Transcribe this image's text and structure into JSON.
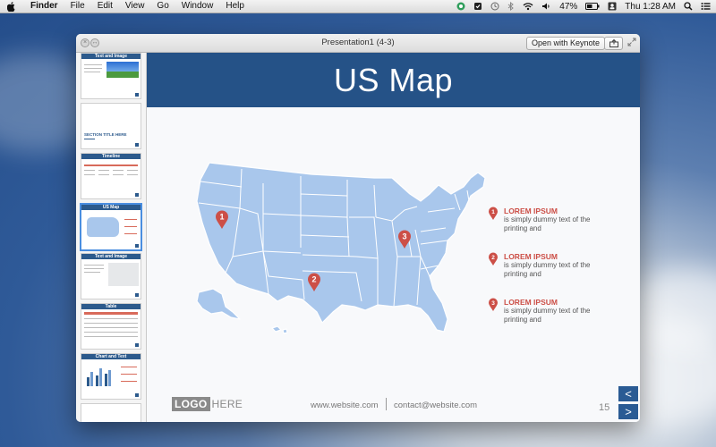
{
  "menubar": {
    "app": "Finder",
    "items": [
      "File",
      "Edit",
      "View",
      "Go",
      "Window",
      "Help"
    ],
    "battery": "47%",
    "clock": "Thu 1:28 AM"
  },
  "window": {
    "title": "Presentation1 (4-3)",
    "open_button": "Open with Keynote"
  },
  "sidebar": {
    "thumbnails": [
      {
        "label": "Text and Image"
      },
      {
        "label": "SECTION TITLE HERE"
      },
      {
        "label": "Timeline"
      },
      {
        "label": "US Map"
      },
      {
        "label": "Text and Image"
      },
      {
        "label": "Table"
      },
      {
        "label": "Chart and Text"
      }
    ]
  },
  "slide": {
    "title": "US Map",
    "pins": [
      "1",
      "2",
      "3"
    ],
    "legend": [
      {
        "number": "1",
        "title": "LOREM IPSUM",
        "line1": "is simply dummy text of the",
        "line2": "printing and"
      },
      {
        "number": "2",
        "title": "LOREM IPSUM",
        "line1": "is simply dummy text of the",
        "line2": "printing and"
      },
      {
        "number": "3",
        "title": "LOREM IPSUM",
        "line1": "is simply dummy text of the",
        "line2": "printing and"
      }
    ],
    "logo_box": "LOGO",
    "logo_here": "HERE",
    "website": "www.website.com",
    "email": "contact@website.com",
    "page_number": "15",
    "prev": "<",
    "next": ">"
  },
  "colors": {
    "header_blue": "#255287",
    "map_fill": "#a9c7ec",
    "pin_red": "#cc4f47"
  }
}
